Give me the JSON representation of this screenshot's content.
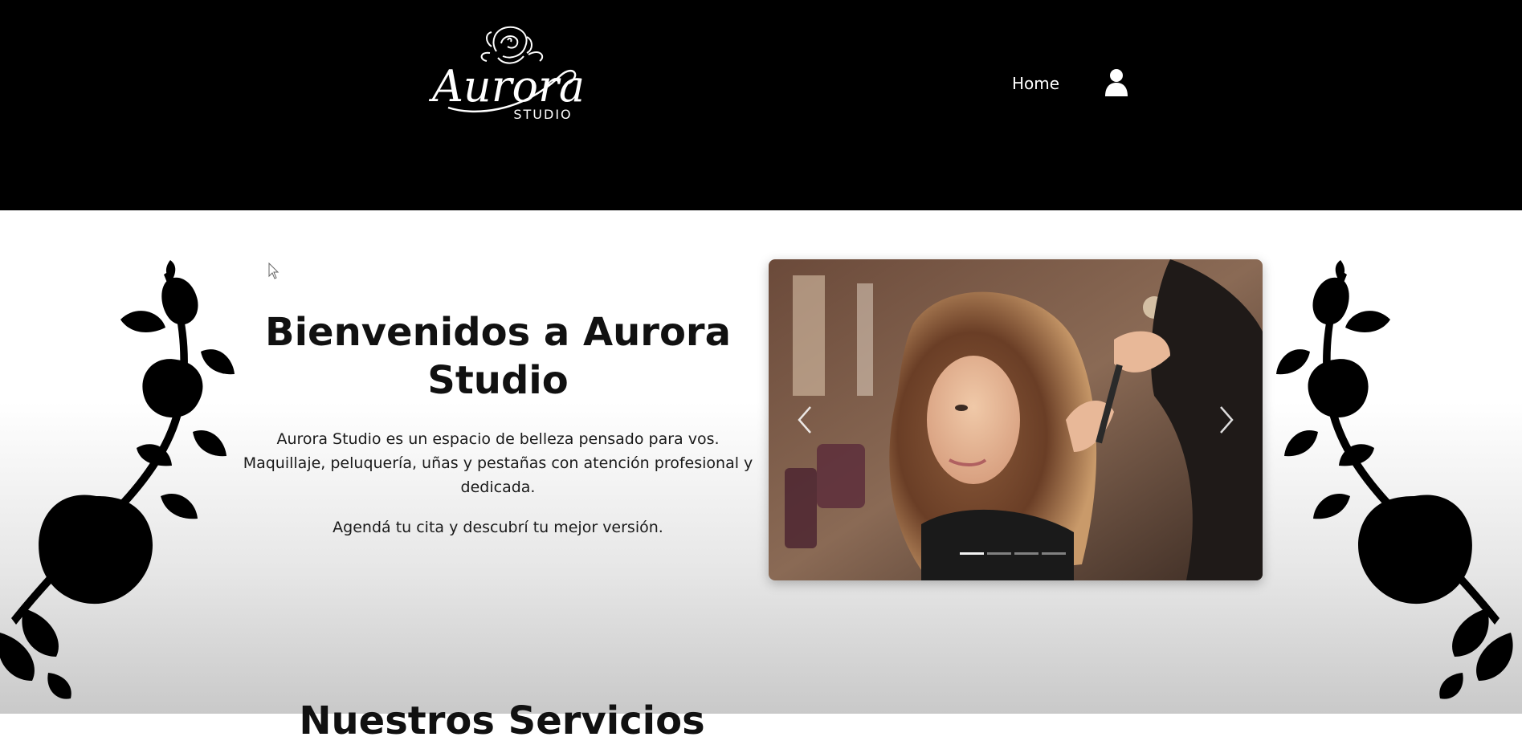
{
  "header": {
    "logo_text": "Aurora",
    "logo_subtext": "STUDIO",
    "nav": {
      "home_label": "Home"
    },
    "icons": {
      "user": "user-icon"
    }
  },
  "hero": {
    "title": "Bienvenidos a Aurora Studio",
    "description": "Aurora Studio es un espacio de belleza pensado para vos. Maquillaje, peluquería, uñas y pestañas con atención profesional y dedicada.",
    "cta_text": "Agendá tu cita y descubrí tu mejor versión."
  },
  "carousel": {
    "prev_icon": "chevron-left-icon",
    "next_icon": "chevron-right-icon",
    "slide_count": 4,
    "active_index": 0
  },
  "services": {
    "title_partial": "Nuestros Servicios"
  },
  "colors": {
    "header_bg": "#000000",
    "text_dark": "#111111",
    "nav_text": "#ffffff"
  }
}
